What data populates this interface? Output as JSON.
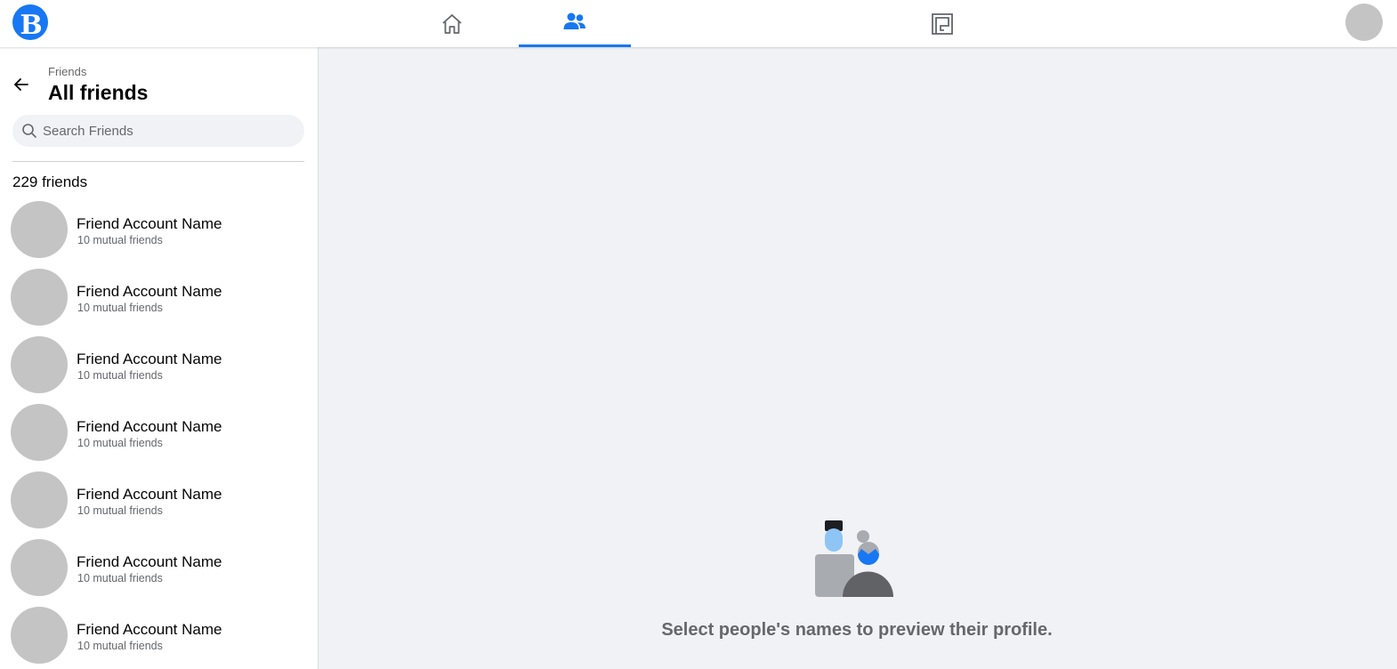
{
  "app": {
    "logo_letter": "B",
    "brand_color": "#1877f2"
  },
  "nav": {
    "tabs": [
      {
        "id": "home",
        "icon": "home-icon",
        "active": false
      },
      {
        "id": "friends",
        "icon": "friends-icon",
        "active": true
      },
      {
        "id": "marketplace",
        "icon": "marketplace-icon",
        "active": false
      }
    ]
  },
  "sidebar": {
    "breadcrumb": "Friends",
    "title": "All friends",
    "search_placeholder": "Search Friends",
    "friend_count": "229 friends",
    "friends": [
      {
        "name": "Friend Account Name",
        "mutual": "10 mutual friends"
      },
      {
        "name": "Friend Account Name",
        "mutual": "10 mutual friends"
      },
      {
        "name": "Friend Account Name",
        "mutual": "10 mutual friends"
      },
      {
        "name": "Friend Account Name",
        "mutual": "10 mutual friends"
      },
      {
        "name": "Friend Account Name",
        "mutual": "10 mutual friends"
      },
      {
        "name": "Friend Account Name",
        "mutual": "10 mutual friends"
      },
      {
        "name": "Friend Account Name",
        "mutual": "10 mutual friends"
      }
    ]
  },
  "main": {
    "empty_message": "Select people's names to preview their profile."
  }
}
